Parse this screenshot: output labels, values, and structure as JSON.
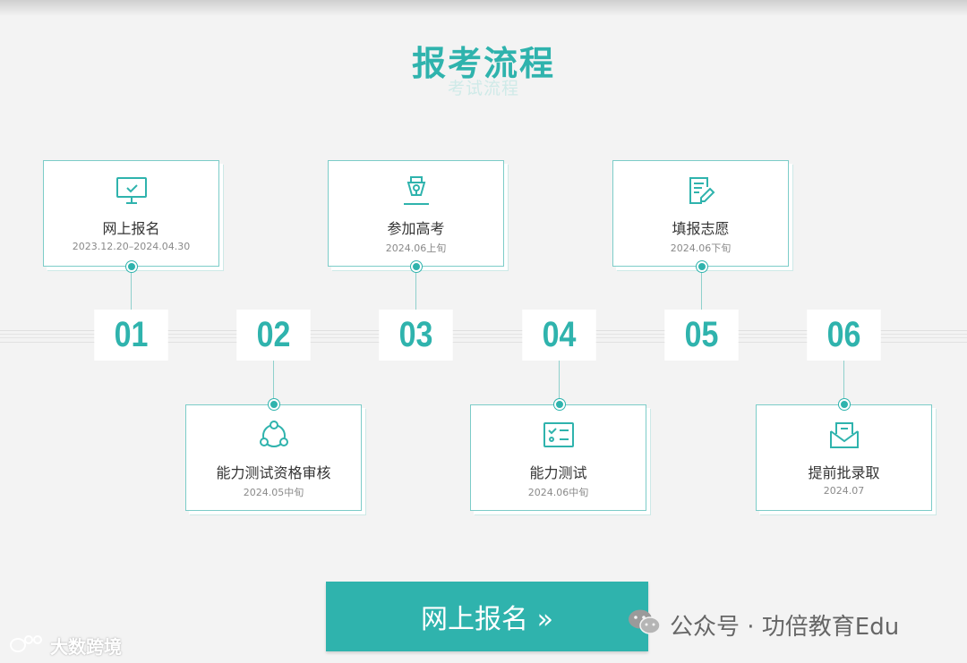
{
  "header": {
    "title": "报考流程",
    "subtitle": "考试流程"
  },
  "steps": [
    {
      "number": "01",
      "label": "网上报名",
      "date": "2023.12.20–2024.04.30",
      "icon": "monitor-check-icon"
    },
    {
      "number": "02",
      "label": "能力测试资格审核",
      "date": "2024.05中旬",
      "icon": "network-nodes-icon"
    },
    {
      "number": "03",
      "label": "参加高考",
      "date": "2024.06上旬",
      "icon": "pen-nib-icon"
    },
    {
      "number": "04",
      "label": "能力测试",
      "date": "2024.06中旬",
      "icon": "checklist-icon"
    },
    {
      "number": "05",
      "label": "填报志愿",
      "date": "2024.06下旬",
      "icon": "edit-document-icon"
    },
    {
      "number": "06",
      "label": "提前批录取",
      "date": "2024.07",
      "icon": "envelope-icon"
    }
  ],
  "cta": {
    "label": "网上报名 »"
  },
  "watermarks": {
    "left": "大数跨境",
    "right": "公众号 · 功倍教育Edu"
  },
  "colors": {
    "accent": "#2fb3ad",
    "background": "#f3f3f3"
  }
}
